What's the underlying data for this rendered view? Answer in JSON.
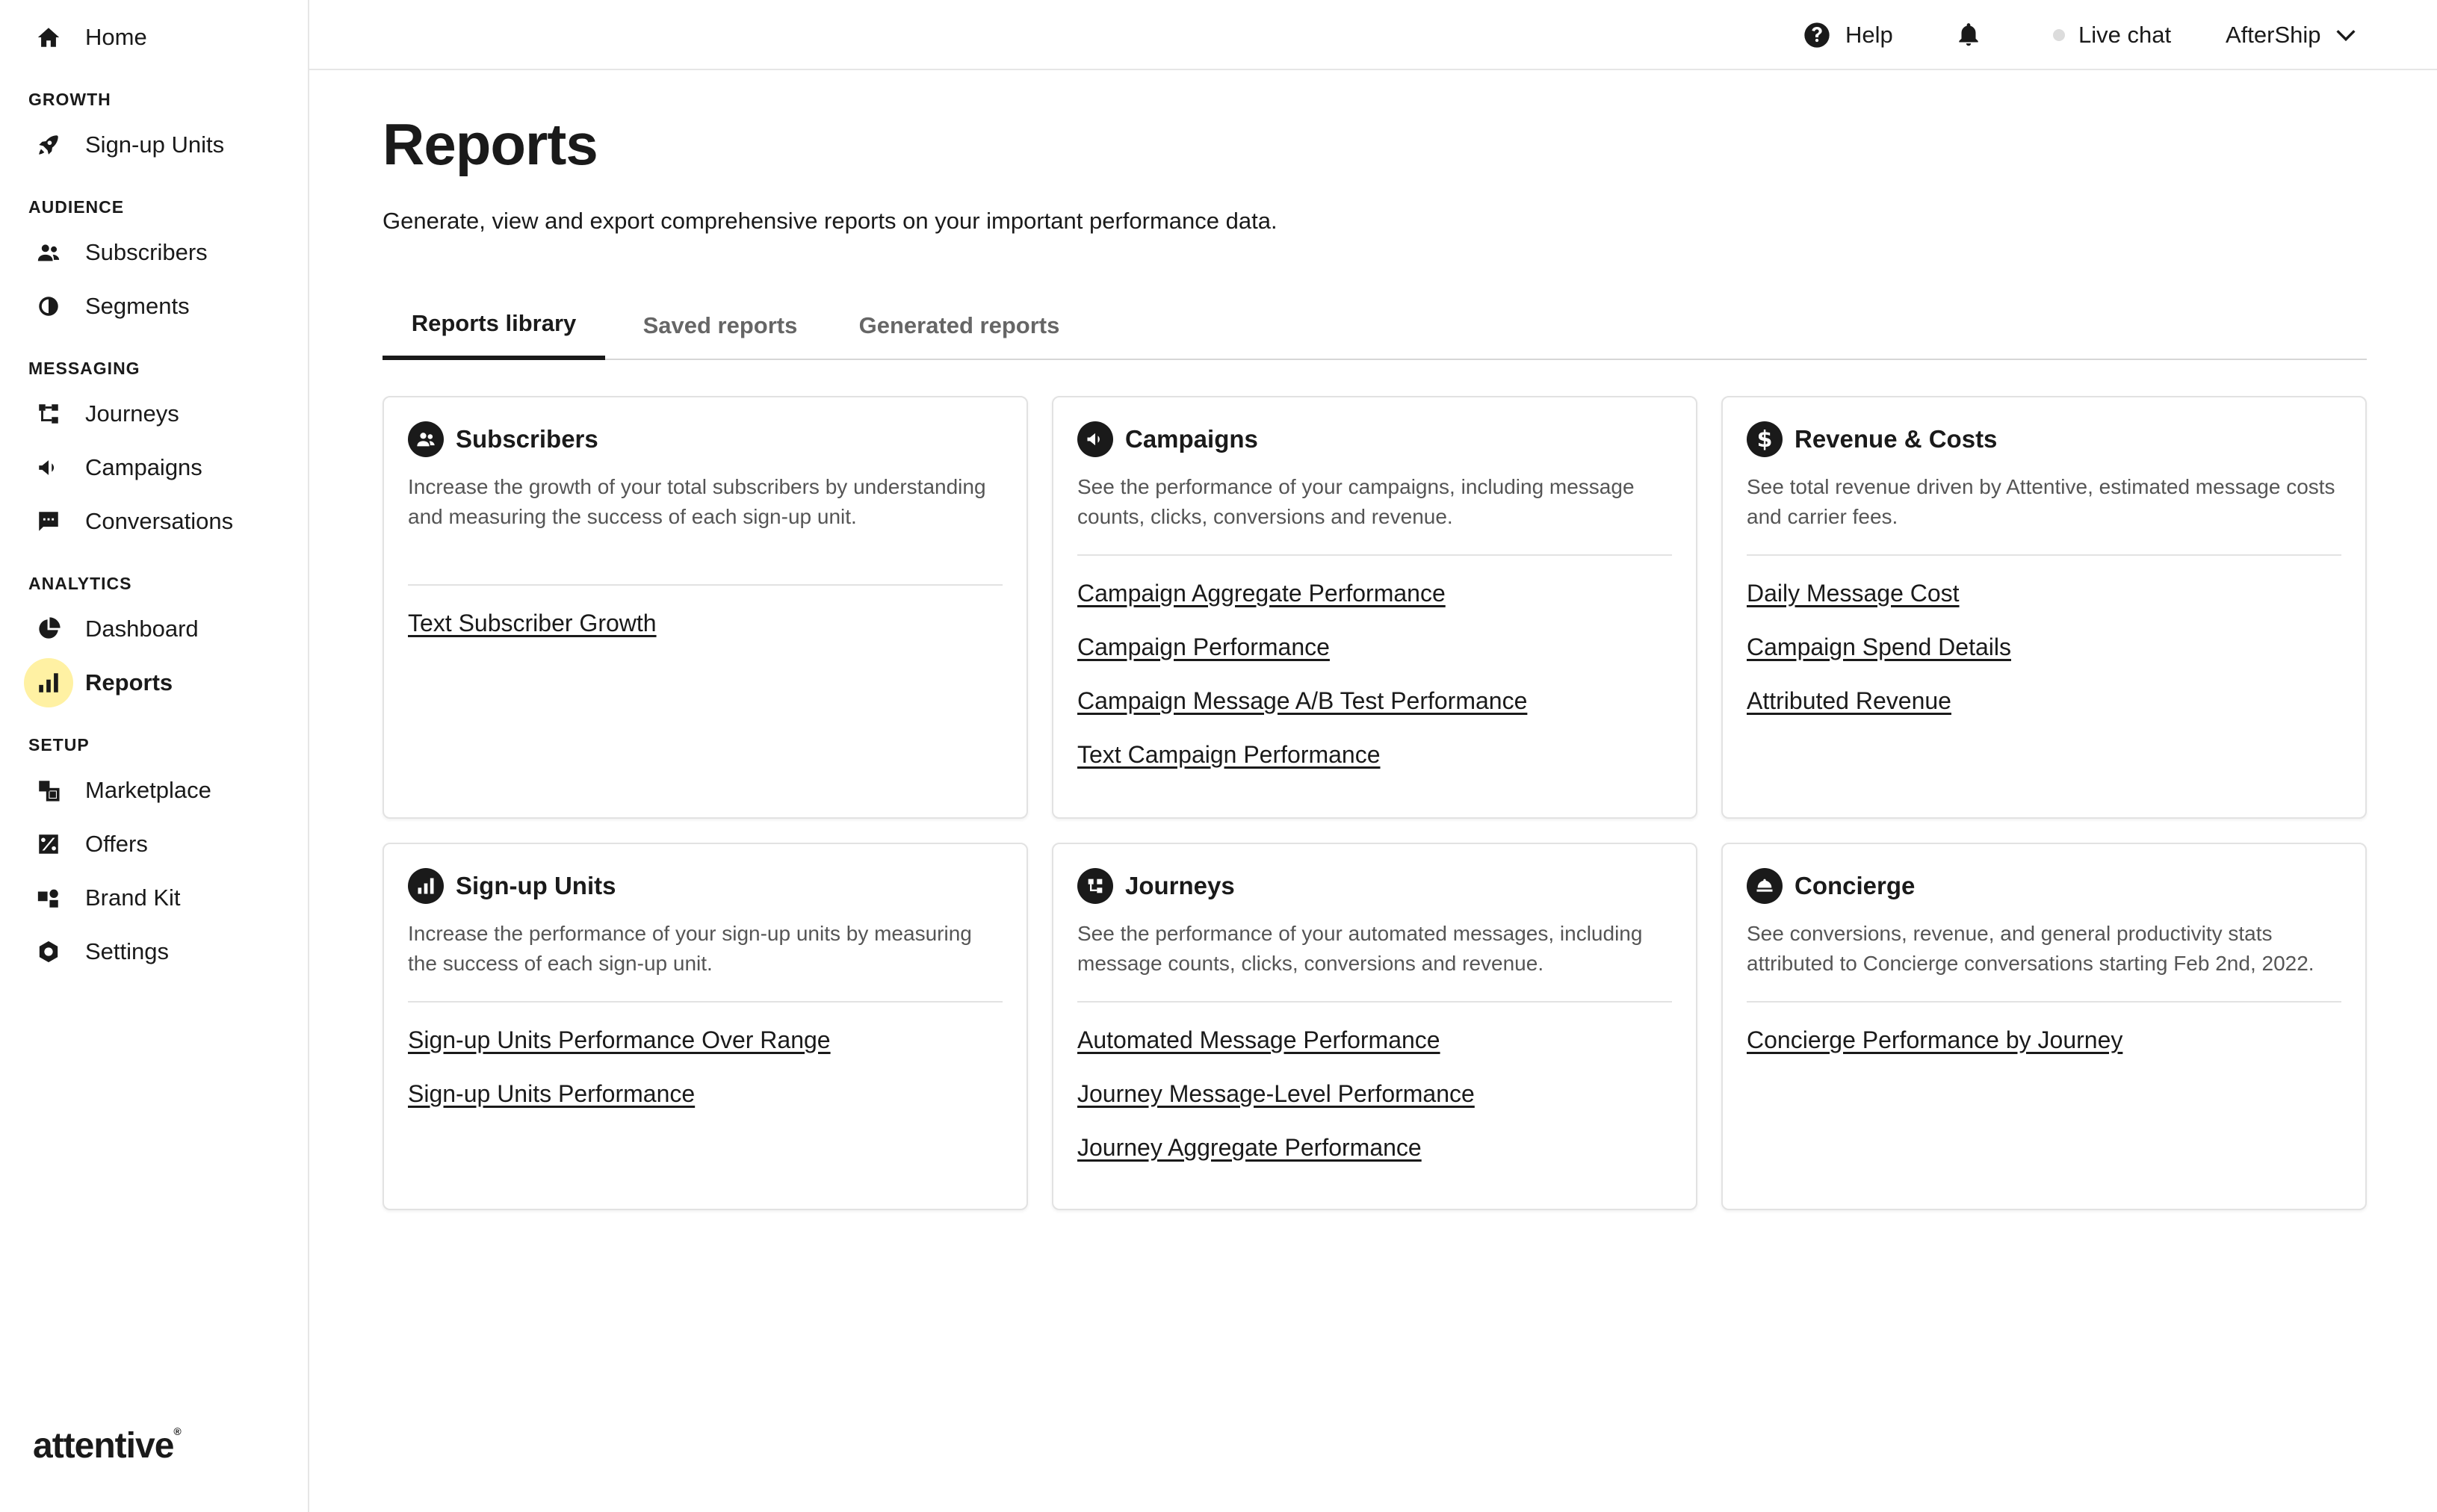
{
  "sidebar": {
    "home": "Home",
    "sections": {
      "growth": "GROWTH",
      "audience": "AUDIENCE",
      "messaging": "MESSAGING",
      "analytics": "ANALYTICS",
      "setup": "SETUP"
    },
    "items": {
      "signup_units": "Sign-up Units",
      "subscribers": "Subscribers",
      "segments": "Segments",
      "journeys": "Journeys",
      "campaigns": "Campaigns",
      "conversations": "Conversations",
      "dashboard": "Dashboard",
      "reports": "Reports",
      "marketplace": "Marketplace",
      "offers": "Offers",
      "brand_kit": "Brand Kit",
      "settings": "Settings"
    },
    "active_item": "reports",
    "logo": "attentive"
  },
  "topbar": {
    "help": "Help",
    "live_chat": "Live chat",
    "account": "AfterShip"
  },
  "main": {
    "title": "Reports",
    "description": "Generate, view and export comprehensive reports on your important performance data.",
    "tabs": [
      "Reports library",
      "Saved reports",
      "Generated reports"
    ],
    "active_tab": 0
  },
  "cards": [
    {
      "title": "Subscribers",
      "icon": "users-icon",
      "description": "Increase the growth of your total subscribers by understanding and measuring the success of each sign-up unit.",
      "links": [
        "Text Subscriber Growth"
      ]
    },
    {
      "title": "Campaigns",
      "icon": "megaphone-icon",
      "description": "See the performance of your campaigns, including message counts, clicks, conversions and revenue.",
      "links": [
        "Campaign Aggregate Performance",
        "Campaign Performance",
        "Campaign Message A/B Test Performance",
        "Text Campaign Performance"
      ]
    },
    {
      "title": "Revenue & Costs",
      "icon": "dollar-icon",
      "description": "See total revenue driven by Attentive, estimated message costs and carrier fees.",
      "links": [
        "Daily Message Cost",
        "Campaign Spend Details",
        "Attributed Revenue"
      ]
    },
    {
      "title": "Sign-up Units",
      "icon": "bar-chart-icon",
      "description": "Increase the performance of your sign-up units by measuring the success of each sign-up unit.",
      "links": [
        "Sign-up Units Performance Over Range",
        "Sign-up Units Performance"
      ]
    },
    {
      "title": "Journeys",
      "icon": "journey-icon",
      "description": "See the performance of your automated messages, including message counts, clicks, conversions and revenue.",
      "links": [
        "Automated Message Performance",
        "Journey Message-Level Performance",
        "Journey Aggregate Performance"
      ]
    },
    {
      "title": "Concierge",
      "icon": "concierge-icon",
      "description": "See conversions, revenue, and general productivity stats attributed to Concierge conversations starting Feb 2nd, 2022.",
      "links": [
        "Concierge Performance by Journey"
      ]
    }
  ],
  "colors": {
    "active_highlight": "#fff1a3",
    "text": "#1a1a1a",
    "border": "#e2e2e2"
  }
}
